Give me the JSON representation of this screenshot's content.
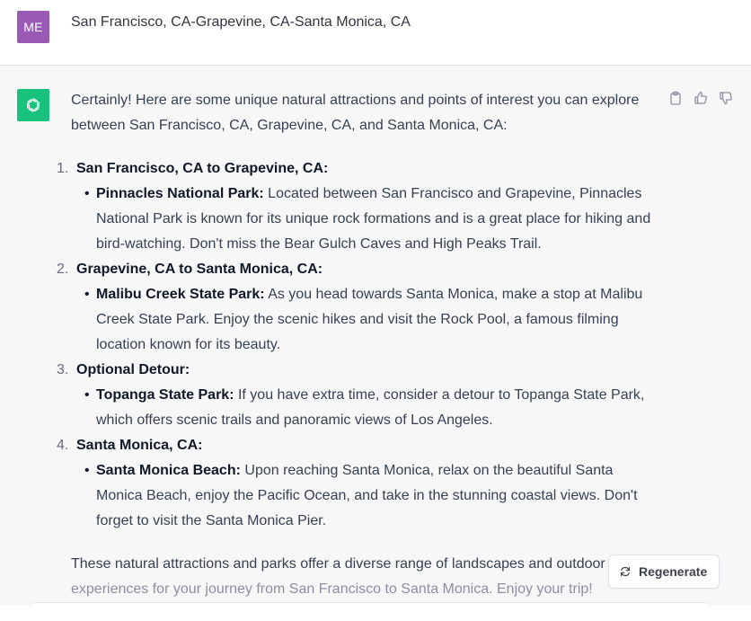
{
  "colors": {
    "user_avatar_bg": "#9b59b6",
    "bot_avatar_bg": "#19c37d"
  },
  "user_message": {
    "avatar_initials": "ME",
    "text": "San Francisco, CA-Grapevine, CA-Santa Monica, CA"
  },
  "assistant_message": {
    "intro": "Certainly! Here are some unique natural attractions and points of interest you can explore between San Francisco, CA, Grapevine, CA, and Santa Monica, CA:",
    "sections": [
      {
        "number": "1.",
        "title": "San Francisco, CA to Grapevine, CA:",
        "place": "Pinnacles National Park:",
        "description": " Located between San Francisco and Grapevine, Pinnacles National Park is known for its unique rock formations and is a great place for hiking and bird-watching. Don't miss the Bear Gulch Caves and High Peaks Trail."
      },
      {
        "number": "2.",
        "title": "Grapevine, CA to Santa Monica, CA:",
        "place": "Malibu Creek State Park:",
        "description": " As you head towards Santa Monica, make a stop at Malibu Creek State Park. Enjoy the scenic hikes and visit the Rock Pool, a famous filming location known for its beauty."
      },
      {
        "number": "3.",
        "title": "Optional Detour:",
        "place": "Topanga State Park:",
        "description": " If you have extra time, consider a detour to Topanga State Park, which offers scenic trails and panoramic views of Los Angeles."
      },
      {
        "number": "4.",
        "title": "Santa Monica, CA:",
        "place": "Santa Monica Beach:",
        "description": " Upon reaching Santa Monica, relax on the beautiful Santa Monica Beach, enjoy the Pacific Ocean, and take in the stunning coastal views. Don't forget to visit the Santa Monica Pier."
      }
    ],
    "outro_line1": "These natural attractions and parks offer a diverse range of landscapes and outdoor",
    "outro_line2": "experiences for your journey from San Francisco to Santa Monica. Enjoy your trip!"
  },
  "actions": {
    "copy_icon": "clipboard-icon",
    "like_icon": "thumbs-up-icon",
    "dislike_icon": "thumbs-down-icon"
  },
  "regenerate": {
    "label": "Regenerate",
    "icon": "refresh-icon"
  }
}
